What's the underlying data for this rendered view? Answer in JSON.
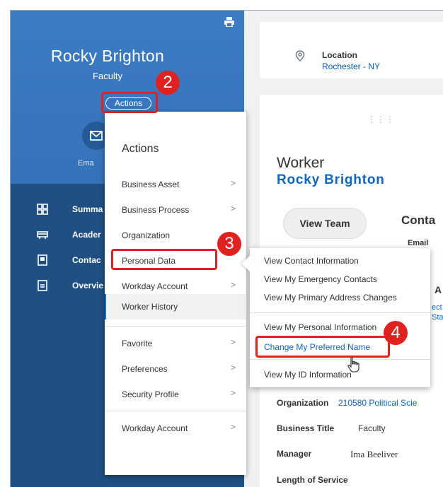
{
  "sidebar": {
    "worker_name": "Rocky Brighton",
    "worker_role": "Faculty",
    "actions_label": "Actions",
    "email_label": "Ema",
    "nav": [
      {
        "label": "Summa",
        "icon": "summary-grid-icon"
      },
      {
        "label": "Acader",
        "icon": "academic-icon"
      },
      {
        "label": "Contac",
        "icon": "contact-card-icon"
      },
      {
        "label": "Overvie",
        "icon": "overview-document-icon"
      }
    ]
  },
  "location_card": {
    "title": "Location",
    "value": "Rochester - NY",
    "icon": "location-pin-icon"
  },
  "worker_card": {
    "heading": "Worker",
    "name": "Rocky Brighton",
    "view_team": "View Team",
    "contact_heading": "Conta",
    "email_label": "Email",
    "ac_cut": "A",
    "ect_line1": "ect",
    "ect_line2": "Sta",
    "fields": [
      {
        "label": "Organization",
        "value": "210580 Political Scie"
      },
      {
        "label": "Business Title",
        "value": "Faculty"
      },
      {
        "label": "Manager",
        "value": "Ima Beeliver"
      }
    ],
    "length_of_service": "Length of Service"
  },
  "actions_menu": {
    "title": "Actions",
    "items": [
      {
        "label": "Business Asset",
        "chevron": true
      },
      {
        "label": "Business Process",
        "chevron": true
      },
      {
        "label": "Organization",
        "chevron": false
      },
      {
        "label": "Personal Data",
        "chevron": false
      },
      {
        "label": "Workday Account",
        "chevron": true
      },
      {
        "label": "Worker History",
        "chevron": false
      },
      {
        "label": "Favorite",
        "chevron": true
      },
      {
        "label": "Preferences",
        "chevron": true
      },
      {
        "label": "Security Profile",
        "chevron": true
      },
      {
        "label": "Workday Account",
        "chevron": true
      }
    ],
    "chevron_glyph": ">"
  },
  "submenu": {
    "items": [
      "View Contact Information",
      "View My Emergency Contacts",
      "View My Primary Address Changes",
      "View My Personal Information",
      "Change My Preferred Name",
      "View My ID Information"
    ]
  },
  "callouts": [
    "2",
    "3",
    "4"
  ],
  "colors": {
    "callout": "#e0211d",
    "link": "#0b66c3",
    "sidebar_top": "#3c7cc4",
    "sidebar_bottom": "#1f4f83"
  }
}
